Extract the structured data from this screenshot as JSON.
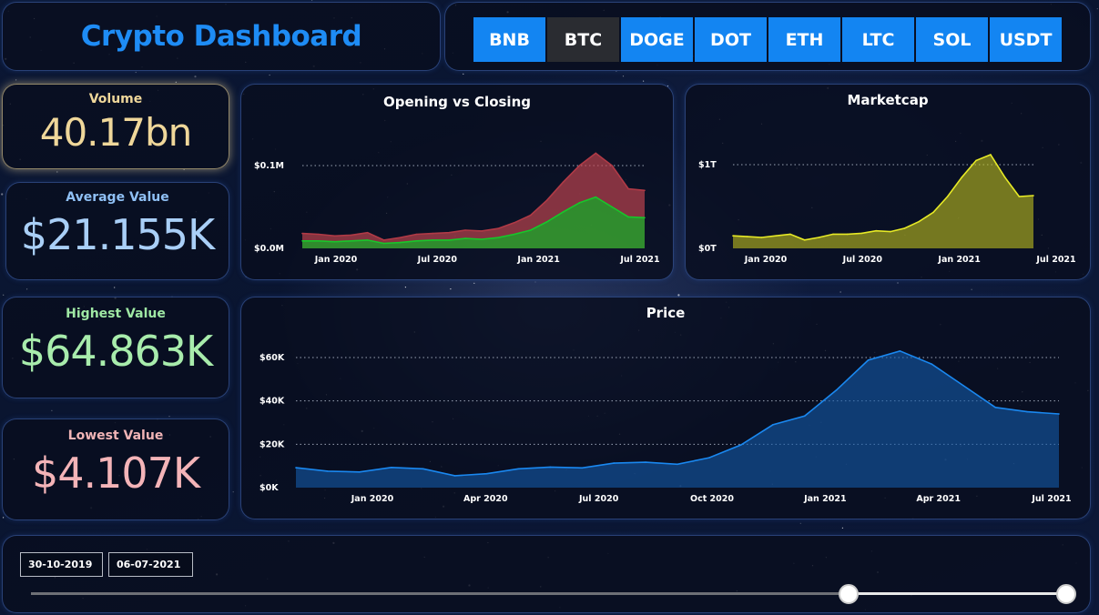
{
  "app_title": "Crypto Dashboard",
  "tabs": [
    {
      "label": "BNB",
      "active": false
    },
    {
      "label": "BTC",
      "active": true
    },
    {
      "label": "DOGE",
      "active": false
    },
    {
      "label": "DOT",
      "active": false
    },
    {
      "label": "ETH",
      "active": false
    },
    {
      "label": "LTC",
      "active": false
    },
    {
      "label": "SOL",
      "active": false
    },
    {
      "label": "USDT",
      "active": false
    }
  ],
  "kpis": {
    "volume": {
      "label": "Volume",
      "value": "40.17bn"
    },
    "average": {
      "label": "Average Value",
      "value": "$21.155K"
    },
    "highest": {
      "label": "Highest Value",
      "value": "$64.863K"
    },
    "lowest": {
      "label": "Lowest Value",
      "value": "$4.107K"
    }
  },
  "date_filter": {
    "start": "30-10-2019",
    "end": "06-07-2021",
    "range_start_fraction": 0.79,
    "range_end_fraction": 1.0
  },
  "colors": {
    "accent": "#1385f2",
    "opening": "#b03a46",
    "closing": "#17c72a",
    "marketcap": "#e7ea26",
    "price": "#1a88f0"
  },
  "chart_data": [
    {
      "type": "area",
      "title": "Opening vs Closing",
      "x_ticks": [
        "Jan 2020",
        "Jul 2020",
        "Jan 2021",
        "Jul 2021"
      ],
      "y_ticks": [
        "$0.0M",
        "$0.1M"
      ],
      "ylim": [
        0,
        0.1
      ],
      "x": [
        "2019-10",
        "2019-11",
        "2019-12",
        "2020-01",
        "2020-02",
        "2020-03",
        "2020-04",
        "2020-05",
        "2020-06",
        "2020-07",
        "2020-08",
        "2020-09",
        "2020-10",
        "2020-11",
        "2020-12",
        "2021-01",
        "2021-02",
        "2021-03",
        "2021-04",
        "2021-05",
        "2021-06",
        "2021-07"
      ],
      "series": [
        {
          "name": "Opening",
          "values": [
            0.018,
            0.017,
            0.015,
            0.016,
            0.019,
            0.01,
            0.013,
            0.017,
            0.018,
            0.019,
            0.022,
            0.021,
            0.024,
            0.031,
            0.04,
            0.058,
            0.08,
            0.1,
            0.115,
            0.1,
            0.072,
            0.07
          ]
        },
        {
          "name": "Closing",
          "values": [
            0.009,
            0.009,
            0.008,
            0.009,
            0.01,
            0.006,
            0.007,
            0.009,
            0.01,
            0.01,
            0.012,
            0.011,
            0.013,
            0.017,
            0.022,
            0.032,
            0.044,
            0.055,
            0.062,
            0.05,
            0.038,
            0.037
          ]
        }
      ]
    },
    {
      "type": "area",
      "title": "Marketcap",
      "x_ticks": [
        "Jan 2020",
        "Jul 2020",
        "Jan 2021",
        "Jul 2021"
      ],
      "y_ticks": [
        "$0T",
        "$1T"
      ],
      "ylim": [
        0,
        1
      ],
      "x": [
        "2019-10",
        "2019-11",
        "2019-12",
        "2020-01",
        "2020-02",
        "2020-03",
        "2020-04",
        "2020-05",
        "2020-06",
        "2020-07",
        "2020-08",
        "2020-09",
        "2020-10",
        "2020-11",
        "2020-12",
        "2021-01",
        "2021-02",
        "2021-03",
        "2021-04",
        "2021-05",
        "2021-06",
        "2021-07"
      ],
      "series": [
        {
          "name": "Marketcap",
          "values": [
            0.15,
            0.14,
            0.13,
            0.15,
            0.17,
            0.1,
            0.13,
            0.17,
            0.17,
            0.18,
            0.21,
            0.2,
            0.24,
            0.32,
            0.43,
            0.62,
            0.85,
            1.05,
            1.12,
            0.85,
            0.62,
            0.63
          ]
        }
      ]
    },
    {
      "type": "area",
      "title": "Price",
      "x_ticks": [
        "Jan 2020",
        "Apr 2020",
        "Jul 2020",
        "Oct 2020",
        "Jan 2021",
        "Apr 2021",
        "Jul 2021"
      ],
      "y_ticks": [
        "$0K",
        "$20K",
        "$40K",
        "$60K"
      ],
      "ylim": [
        0,
        60000
      ],
      "x": [
        "2019-10-30",
        "2019-11-30",
        "2019-12-31",
        "2020-01-31",
        "2020-02-29",
        "2020-03-15",
        "2020-03-31",
        "2020-04-30",
        "2020-05-31",
        "2020-06-30",
        "2020-07-31",
        "2020-08-31",
        "2020-09-30",
        "2020-10-31",
        "2020-11-30",
        "2020-12-31",
        "2021-01-31",
        "2021-02-28",
        "2021-03-31",
        "2021-04-15",
        "2021-04-30",
        "2021-05-15",
        "2021-05-31",
        "2021-06-30",
        "2021-07-06"
      ],
      "series": [
        {
          "name": "Price",
          "values": [
            9200,
            7600,
            7200,
            9300,
            8700,
            5500,
            6400,
            8700,
            9500,
            9100,
            11300,
            11700,
            10800,
            13800,
            19700,
            29000,
            33000,
            45000,
            58800,
            63000,
            57000,
            47000,
            37000,
            35000,
            34000
          ]
        }
      ]
    }
  ]
}
